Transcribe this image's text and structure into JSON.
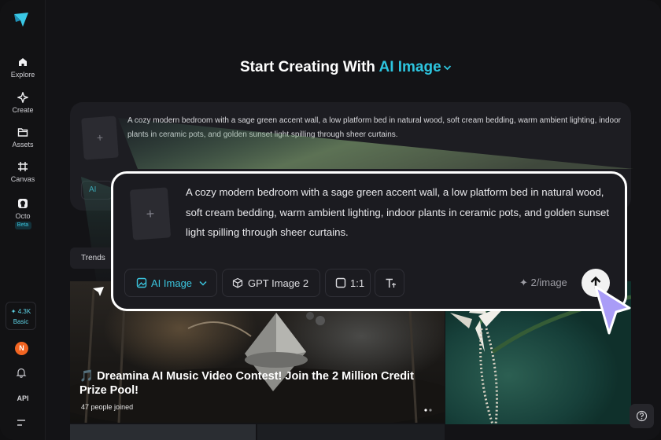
{
  "sidebar": {
    "items": [
      {
        "label": "Explore",
        "icon": "home-icon"
      },
      {
        "label": "Create",
        "icon": "sparkle-icon"
      },
      {
        "label": "Assets",
        "icon": "folder-icon"
      },
      {
        "label": "Canvas",
        "icon": "canvas-icon"
      },
      {
        "label": "Octo",
        "icon": "octo-icon",
        "badge": "Beta"
      }
    ],
    "credits": {
      "amount": "4.3K",
      "plan": "Basic"
    },
    "avatar_letter": "N",
    "api_label": "API"
  },
  "main": {
    "heading_prefix": "Start Creating With",
    "heading_mode": "AI Image",
    "background_prompt": {
      "text": "A cozy modern bedroom with a sage green accent wall, a low platform bed in natural wood, soft cream bedding, warm ambient lighting, indoor plants in ceramic pots, and golden sunset light spilling through sheer curtains.",
      "chip_label": "AI"
    },
    "tabs": [
      {
        "label": "Trends"
      }
    ],
    "banner": {
      "title": "🎵 Dreamina AI Music Video Contest! Join the 2 Million Credit Prize Pool!",
      "joined": "47",
      "joined_suffix": "people joined"
    }
  },
  "prompt_card": {
    "text": "A cozy modern bedroom with a sage green accent wall, a low platform bed in natural wood, soft cream bedding, warm ambient lighting, indoor plants in ceramic pots, and golden sunset light spilling through sheer curtains.",
    "mode_label": "AI Image",
    "model_label": "GPT Image 2",
    "ratio_label": "1:1",
    "cost_label": "2/image"
  },
  "colors": {
    "accent": "#2dc5df",
    "background": "#131316",
    "card": "#1b1b20",
    "cursor": "#a99cf7"
  }
}
